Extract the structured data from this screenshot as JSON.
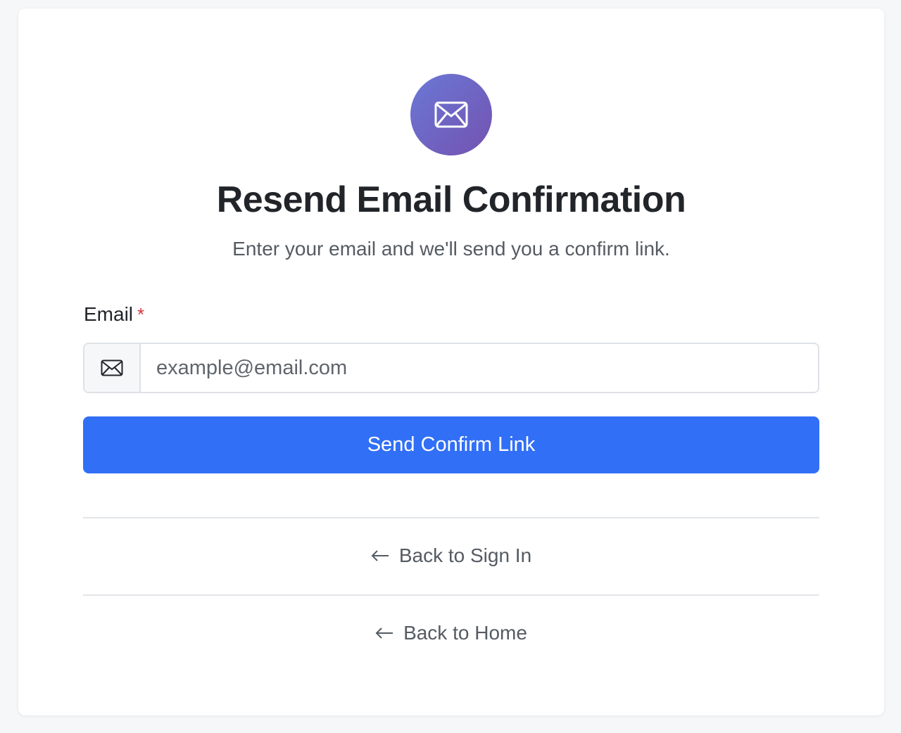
{
  "header": {
    "icon": "envelope-icon",
    "title": "Resend Email Confirmation",
    "subtitle": "Enter your email and we'll send you a confirm link."
  },
  "form": {
    "email_label": "Email",
    "required_marker": "*",
    "email_icon": "envelope-icon",
    "email_placeholder": "example@email.com",
    "email_value": "",
    "submit_label": "Send Confirm Link"
  },
  "links": {
    "back_to_sign_in": "Back to Sign In",
    "back_to_home": "Back to Home",
    "arrow_icon": "arrow-left-icon"
  },
  "colors": {
    "primary": "#316ff6",
    "required": "#d3373f",
    "icon_gradient_start": "#6a78d6",
    "icon_gradient_end": "#7452b0"
  }
}
